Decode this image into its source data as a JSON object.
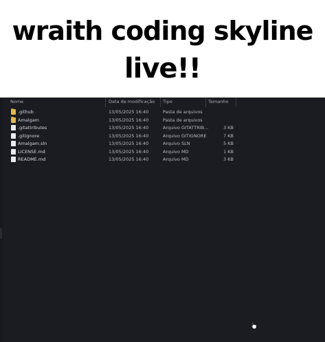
{
  "caption": {
    "line1": "wraith coding skyline",
    "line2": "live!!"
  },
  "columns": {
    "name": "Nome",
    "date": "Data de modificação",
    "type": "Tipo",
    "size": "Tamanho"
  },
  "files": [
    {
      "name": ".github",
      "date": "13/05/2025 16:40",
      "type": "Pasta de arquivos",
      "size": "",
      "icon": "folder-icon"
    },
    {
      "name": "Amalgam",
      "date": "13/05/2025 16:40",
      "type": "Pasta de arquivos",
      "size": "",
      "icon": "folder-icon"
    },
    {
      "name": ".gitattributes",
      "date": "13/05/2025 16:40",
      "type": "Arquivo GITATTRIB...",
      "size": "3 KB",
      "icon": "file-icon"
    },
    {
      "name": ".gitignore",
      "date": "13/05/2025 16:40",
      "type": "Arquivo GITIGNORE",
      "size": "7 KB",
      "icon": "file-icon"
    },
    {
      "name": "Amalgam.sln",
      "date": "13/05/2025 16:40",
      "type": "Arquivo SLN",
      "size": "5 KB",
      "icon": "file-icon"
    },
    {
      "name": "LICENSE.md",
      "date": "13/05/2025 16:40",
      "type": "Arquivo MD",
      "size": "1 KB",
      "icon": "file-icon"
    },
    {
      "name": "README.md",
      "date": "13/05/2025 16:40",
      "type": "Arquivo MD",
      "size": "3 KB",
      "icon": "file-icon"
    }
  ],
  "colors": {
    "background": "#1b1c22",
    "caption_bg": "#ffffff",
    "folder": "#e8b94a"
  }
}
